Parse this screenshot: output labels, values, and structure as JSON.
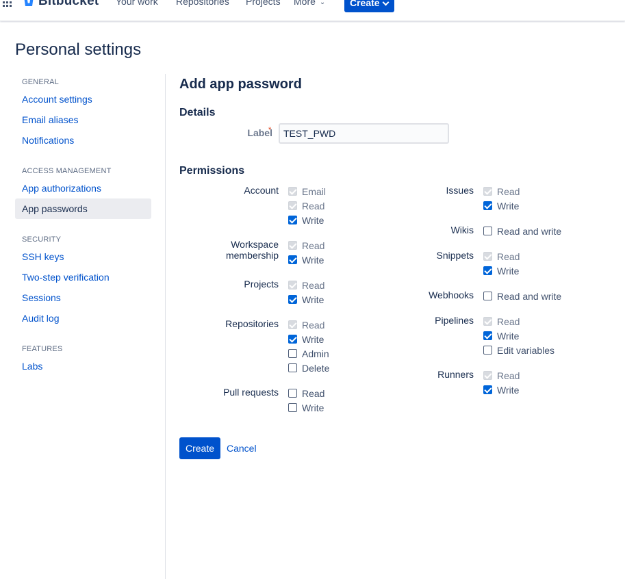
{
  "topnav": {
    "logo_text": "Bitbucket",
    "items": [
      "Your work",
      "Repositories",
      "Projects",
      "More"
    ],
    "create_label": "Create"
  },
  "page_title": "Personal settings",
  "sidebar": {
    "general_heading": "GENERAL",
    "account_settings": "Account settings",
    "email_aliases": "Email aliases",
    "notifications": "Notifications",
    "access_heading": "ACCESS MANAGEMENT",
    "app_authorizations": "App authorizations",
    "app_passwords": "App passwords",
    "security_heading": "SECURITY",
    "ssh_keys": "SSH keys",
    "two_step": "Two-step verification",
    "sessions": "Sessions",
    "audit_log": "Audit log",
    "features_heading": "FEATURES",
    "labs": "Labs"
  },
  "form": {
    "title": "Add app password",
    "details_heading": "Details",
    "label_label": "Label",
    "required_mark": "*",
    "label_value": "TEST_PWD",
    "permissions_heading": "Permissions",
    "create_button": "Create",
    "cancel_link": "Cancel"
  },
  "permissions": {
    "account": {
      "label": "Account",
      "options": [
        {
          "text": "Email",
          "state": "checked-disabled"
        },
        {
          "text": "Read",
          "state": "checked-disabled"
        },
        {
          "text": "Write",
          "state": "checked"
        }
      ]
    },
    "workspace": {
      "label_line1": "Workspace",
      "label_line2": "membership",
      "options": [
        {
          "text": "Read",
          "state": "checked-disabled"
        },
        {
          "text": "Write",
          "state": "checked"
        }
      ]
    },
    "projects": {
      "label": "Projects",
      "options": [
        {
          "text": "Read",
          "state": "checked-disabled"
        },
        {
          "text": "Write",
          "state": "checked"
        }
      ]
    },
    "repositories": {
      "label": "Repositories",
      "options": [
        {
          "text": "Read",
          "state": "checked-disabled"
        },
        {
          "text": "Write",
          "state": "checked"
        },
        {
          "text": "Admin",
          "state": "unchecked"
        },
        {
          "text": "Delete",
          "state": "unchecked"
        }
      ]
    },
    "pull_requests": {
      "label": "Pull requests",
      "options": [
        {
          "text": "Read",
          "state": "unchecked"
        },
        {
          "text": "Write",
          "state": "unchecked"
        }
      ]
    },
    "issues": {
      "label": "Issues",
      "options": [
        {
          "text": "Read",
          "state": "checked-disabled"
        },
        {
          "text": "Write",
          "state": "checked"
        }
      ]
    },
    "wikis": {
      "label": "Wikis",
      "options": [
        {
          "text": "Read and write",
          "state": "unchecked"
        }
      ]
    },
    "snippets": {
      "label": "Snippets",
      "options": [
        {
          "text": "Read",
          "state": "checked-disabled"
        },
        {
          "text": "Write",
          "state": "checked"
        }
      ]
    },
    "webhooks": {
      "label": "Webhooks",
      "options": [
        {
          "text": "Read and write",
          "state": "unchecked"
        }
      ]
    },
    "pipelines": {
      "label": "Pipelines",
      "options": [
        {
          "text": "Read",
          "state": "checked-disabled"
        },
        {
          "text": "Write",
          "state": "checked"
        },
        {
          "text": "Edit variables",
          "state": "unchecked"
        }
      ]
    },
    "runners": {
      "label": "Runners",
      "options": [
        {
          "text": "Read",
          "state": "checked-disabled"
        },
        {
          "text": "Write",
          "state": "checked"
        }
      ]
    }
  }
}
